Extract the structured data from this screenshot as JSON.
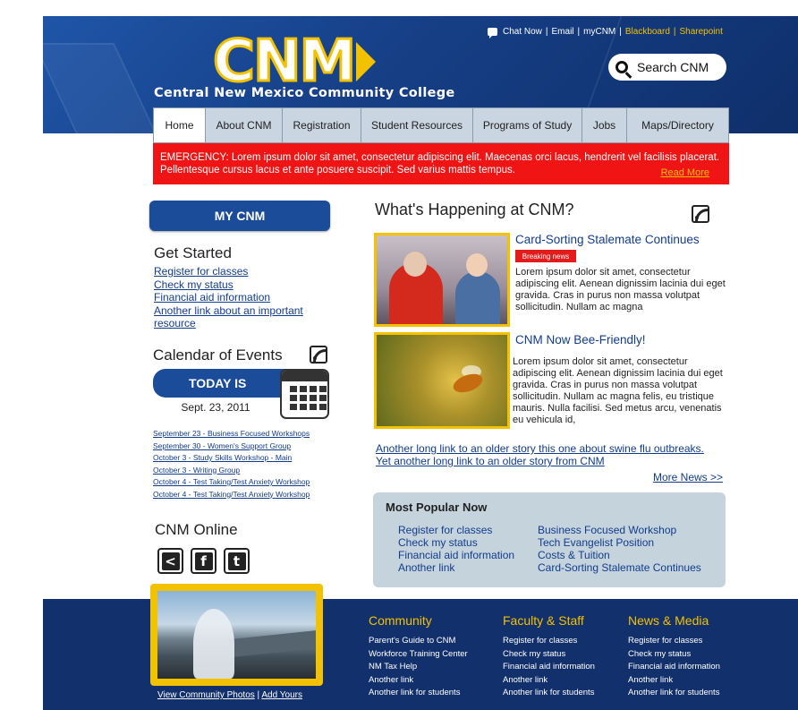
{
  "header": {
    "logo_text": "CNM",
    "college_name": "Central New Mexico Community College",
    "utility_links": [
      {
        "label": "Chat Now"
      },
      {
        "label": "Email"
      },
      {
        "label": "myCNM"
      },
      {
        "label": "Blackboard"
      },
      {
        "label": "Sharepoint"
      }
    ],
    "search_label": "Search CNM"
  },
  "nav": {
    "tabs": [
      "Home",
      "About CNM",
      "Registration",
      "Student Resources",
      "Programs of Study",
      "Jobs",
      "Maps/Directory"
    ],
    "active": "Home"
  },
  "emergency": {
    "text": "EMERGENCY: Lorem ipsum dolor sit amet, consectetur adipiscing elit. Maecenas orci lacus, hendrerit vel facilisis placerat. Pellentesque cursus lacus et ante posuere suscipit. Sed varius mattis tempus.",
    "read_more": "Read More"
  },
  "left": {
    "mycnm_label": "MY CNM",
    "get_started": {
      "heading": "Get Started",
      "links": [
        "Register for classes",
        "Check my status",
        "Financial aid information",
        "Another link about an important resource"
      ]
    },
    "calendar": {
      "heading": "Calendar of Events",
      "today_label": "TODAY IS",
      "date": "Sept. 23, 2011",
      "events": [
        "September 23 - Business Focused Workshops",
        "September 30 - Women's Support Group",
        "October 3 - Study Skills Workshop - Main",
        "October 3 - Writing Group",
        "October 4 - Test Taking/Test Anxiety Workshop",
        "October 4 - Test Taking/Test Anxiety Workshop"
      ]
    },
    "online": {
      "heading": "CNM Online"
    }
  },
  "news": {
    "heading": "What's Happening at CNM?",
    "stories": [
      {
        "title": "Card-Sorting Stalemate Continues",
        "badge": "Breaking news",
        "body": "Lorem ipsum dolor sit amet, consectetur adipiscing elit. Aenean dignissim lacinia dui eget gravida. Cras in purus non massa volutpat sollicitudin. Nullam ac magna"
      },
      {
        "title": "CNM Now Bee-Friendly!",
        "body": "Lorem ipsum dolor sit amet, consectetur adipiscing elit. Aenean dignissim lacinia dui eget gravida. Cras in purus non massa volutpat sollicitudin. Nullam ac magna felis, eu tristique mauris. Nulla facilisi. Sed metus arcu, venenatis eu vehicula id,"
      }
    ],
    "older_links": [
      "Another long link to an older story this one about swine flu outbreaks.",
      "Yet another long link to an older story from CNM"
    ],
    "more_news": "More News >>"
  },
  "popular": {
    "heading": "Most Popular Now",
    "left": [
      "Register for classes",
      "Check my status",
      "Financial aid information",
      "Another link"
    ],
    "right": [
      "Business Focused Workshop",
      "Tech Evangelist Position",
      "Costs & Tuition",
      "Card-Sorting Stalemate Continues"
    ]
  },
  "footer": {
    "photo_links": [
      "View Community Photos",
      "Add Yours"
    ],
    "columns": [
      {
        "heading": "Community",
        "links": [
          "Parent's Guide to CNM",
          "Workforce Training Center",
          "NM Tax Help",
          "Another link",
          "Another link for students"
        ]
      },
      {
        "heading": "Faculty & Staff",
        "links": [
          "Register for classes",
          "Check my status",
          "Financial aid information",
          "Another link",
          "Another link for students"
        ]
      },
      {
        "heading": "News & Media",
        "links": [
          "Register for classes",
          "Check my status",
          "Financial aid information",
          "Another link",
          "Another link for students"
        ]
      }
    ]
  },
  "colors": {
    "brand_blue": "#16438f",
    "brand_yellow": "#f2c200",
    "emergency_red": "#f01414",
    "footer_navy": "#12306c",
    "link_blue": "#123c8c"
  }
}
